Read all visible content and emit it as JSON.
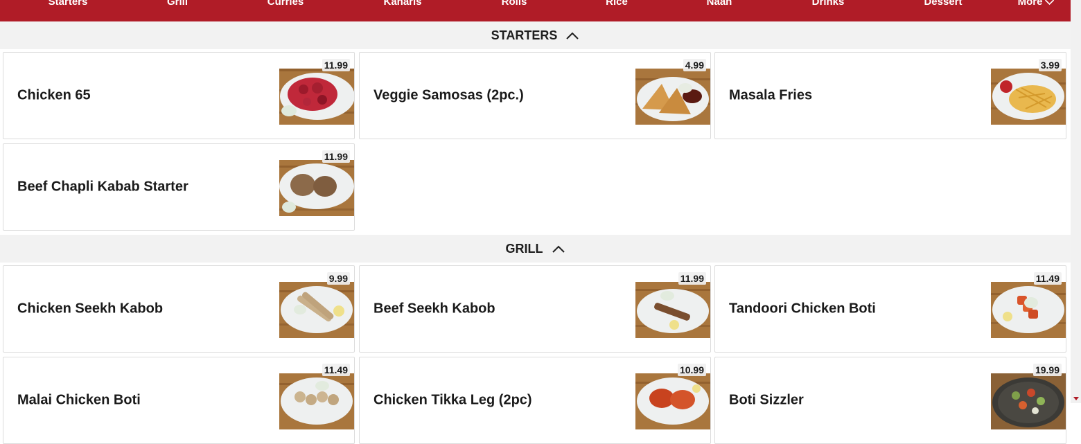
{
  "nav": {
    "items": [
      "Starters",
      "Grill",
      "Curries",
      "Kaharis",
      "Rolls",
      "Rice",
      "Naan",
      "Drinks",
      "Dessert"
    ],
    "more_label": "More",
    "accent_color": "#b01c27"
  },
  "sections": [
    {
      "title": "STARTERS",
      "items": [
        {
          "name": "Chicken 65",
          "price": "11.99"
        },
        {
          "name": "Veggie Samosas (2pc.)",
          "price": "4.99"
        },
        {
          "name": "Masala Fries",
          "price": "3.99"
        },
        {
          "name": "Beef Chapli Kabab Starter",
          "price": "11.99"
        }
      ]
    },
    {
      "title": "GRILL",
      "items": [
        {
          "name": "Chicken Seekh Kabob",
          "price": "9.99"
        },
        {
          "name": "Beef Seekh Kabob",
          "price": "11.99"
        },
        {
          "name": "Tandoori Chicken Boti",
          "price": "11.49"
        },
        {
          "name": "Malai Chicken Boti",
          "price": "11.49"
        },
        {
          "name": "Chicken Tikka Leg (2pc)",
          "price": "10.99"
        },
        {
          "name": "Boti Sizzler",
          "price": "19.99"
        }
      ]
    }
  ]
}
